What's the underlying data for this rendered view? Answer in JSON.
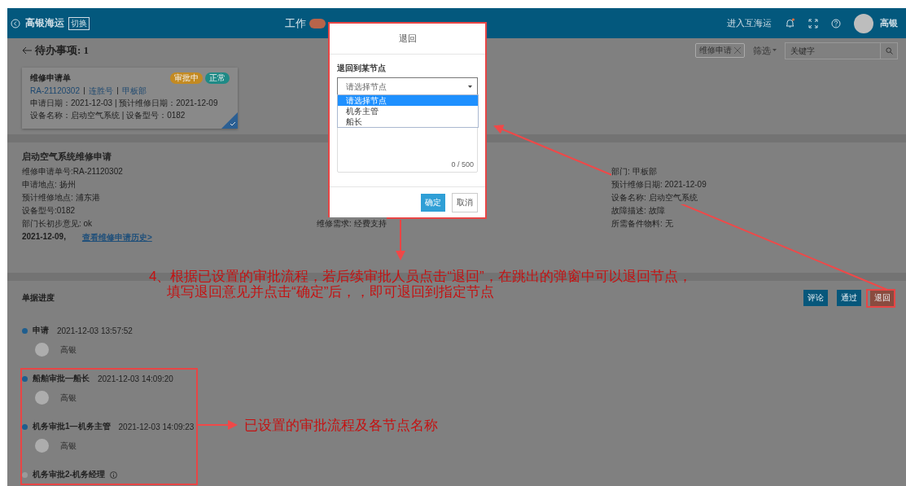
{
  "header": {
    "brand": "高银海运",
    "switch_label": "切换",
    "nav": [
      {
        "label": "工作",
        "selected": true
      }
    ],
    "portal_link": "进入互海运",
    "notification_dot": true,
    "user": "高银"
  },
  "todo": {
    "title": "待办事项: 1",
    "filter_tag": "维修申请",
    "filter_label": "筛选",
    "search": {
      "placeholder": "关键字"
    }
  },
  "card": {
    "title": "维修申请单",
    "badges": [
      {
        "label": "审批中",
        "color": "#c38a22"
      },
      {
        "label": "正常",
        "color": "#1f8a86"
      }
    ],
    "links": [
      "RA-21120302",
      "连胜号",
      "甲板部"
    ],
    "dates": "申请日期：2021-12-03 | 预计维修日期：2021-12-09",
    "equipment": "设备名称：启动空气系统 | 设备型号：0182",
    "checked": true
  },
  "detail": {
    "title": "启动空气系统维修申请",
    "column_1": [
      "维修申请单号:RA-21120302",
      "申请地点: 扬州",
      "预计维修地点: 浦东港",
      "设备型号:0182",
      "部门长初步意见: ok"
    ],
    "column_2": [
      "维修需求: 经费支持"
    ],
    "column_3": [
      "部门: 甲板部",
      "预计维修日期: 2021-12-09",
      "设备名称: 启动空气系统",
      "故障描述: 故障",
      "所需备件物料: 无"
    ],
    "date": "2021-12-09,",
    "history_link": "查看维修申请历史>"
  },
  "progress": {
    "title": "单据进度",
    "buttons": [
      {
        "label": "评论",
        "kind": "normal"
      },
      {
        "label": "通过",
        "kind": "normal"
      },
      {
        "label": "退回",
        "kind": "danger"
      }
    ],
    "steps": [
      {
        "name": "申请",
        "time": "2021-12-03 13:57:52",
        "user": "高银",
        "done": true
      },
      {
        "name": "船舶审批—船长",
        "time": "2021-12-03 14:09:20",
        "user": "高银",
        "done": true
      },
      {
        "name": "机务审批1—机务主管",
        "time": "2021-12-03 14:09:23",
        "user": "高银",
        "done": true
      },
      {
        "name": "机务审批2-机务经理",
        "done": false
      }
    ]
  },
  "dialog": {
    "title": "退回",
    "field_label": "退回到某节点",
    "select": {
      "placeholder": "请选择节点"
    },
    "options": [
      {
        "label": "请选择节点",
        "selected": true
      },
      {
        "label": "机务主管",
        "selected": false
      },
      {
        "label": "船长",
        "selected": false
      }
    ],
    "counter": "0 / 500",
    "buttons": [
      {
        "label": "确定",
        "kind": "primary"
      },
      {
        "label": "取消",
        "kind": "normal"
      }
    ]
  },
  "annotations": {
    "main_note": [
      "4、根据已设置的审批流程，若后续审批人员点击“退回”，在跳出的弹窗中可以退回节点，",
      "填写退回意见并点击“确定”后，，即可退回到指定节点"
    ],
    "flow_note": "已设置的审批流程及各节点名称"
  }
}
